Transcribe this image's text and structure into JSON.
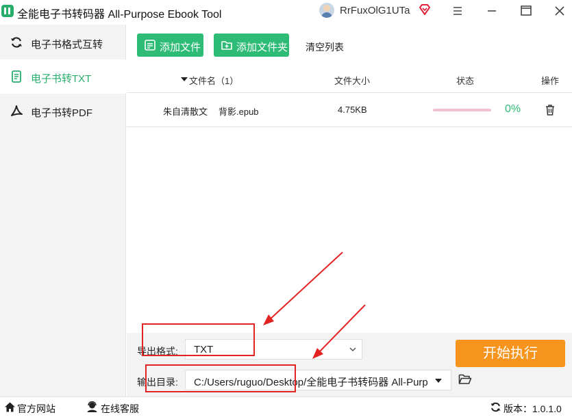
{
  "window": {
    "title": "全能电子书转码器 All-Purpose Ebook Tool",
    "username": "RrFuxOlG1UTa",
    "icons": {
      "logo": "app-logo-icon",
      "vip": "diamond-icon",
      "menu": "hamburger-icon",
      "minimize": "minimize-icon",
      "maximize": "maximize-icon",
      "close": "close-icon"
    }
  },
  "sidebar": {
    "items": [
      {
        "label": "电子书格式互转",
        "icon": "refresh-icon",
        "active": false
      },
      {
        "label": "电子书转TXT",
        "icon": "document-icon",
        "active": true
      },
      {
        "label": "电子书转PDF",
        "icon": "pdf-icon",
        "active": false
      }
    ]
  },
  "toolbar": {
    "add_file": "添加文件",
    "add_folder": "添加文件夹",
    "clear_list": "清空列表"
  },
  "table": {
    "headers": {
      "filename": "文件名（1）",
      "size": "文件大小",
      "status": "状态",
      "action": "操作"
    },
    "rows": [
      {
        "author": "朱自清散文",
        "name": "背影.epub",
        "size": "4.75KB",
        "progress": 0,
        "percent": "0%"
      }
    ]
  },
  "settings": {
    "format_label": "导出格式:",
    "format_value": "TXT",
    "dir_label": "输出目录:",
    "dir_value": "C:/Users/ruguo/Desktop/全能电子书转码器 All-Purp",
    "start_button": "开始执行"
  },
  "statusbar": {
    "website": "官方网站",
    "support": "在线客服",
    "version": "版本：1.0.1.0"
  },
  "colors": {
    "accent": "#2dbb76",
    "start": "#f7941d",
    "progress_track": "#f2c3cf",
    "annotation": "#e32222"
  }
}
